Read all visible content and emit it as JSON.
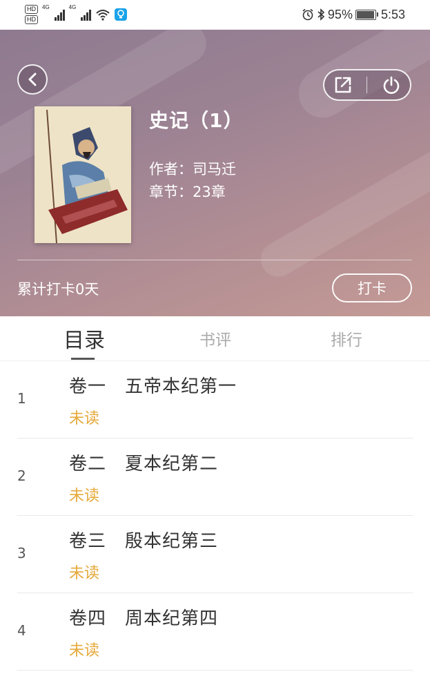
{
  "status_bar": {
    "hd_top": "HD",
    "hd_bottom": "HD",
    "net1": "4G",
    "net2": "4G",
    "battery": "95%",
    "time": "5:53"
  },
  "book": {
    "title": "史记（1）",
    "author": "作者：司马迁",
    "chapters": "章节：23章"
  },
  "checkin": {
    "total": "累计打卡0天",
    "button": "打卡"
  },
  "tabs": [
    {
      "label": "目录",
      "active": true
    },
    {
      "label": "书评",
      "active": false
    },
    {
      "label": "排行",
      "active": false
    }
  ],
  "chapters": [
    {
      "num": "1",
      "title": "卷一　五帝本纪第一",
      "status": "未读"
    },
    {
      "num": "2",
      "title": "卷二　夏本纪第二",
      "status": "未读"
    },
    {
      "num": "3",
      "title": "卷三　殷本纪第三",
      "status": "未读"
    },
    {
      "num": "4",
      "title": "卷四　周本纪第四",
      "status": "未读"
    }
  ],
  "colors": {
    "unread": "#e5a93a"
  }
}
